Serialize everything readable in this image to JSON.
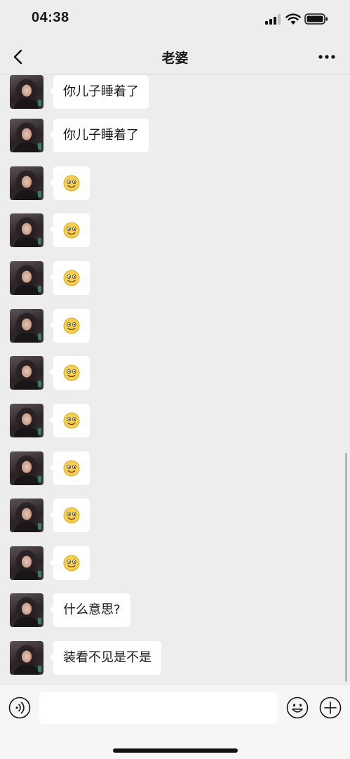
{
  "status": {
    "time": "04:38"
  },
  "header": {
    "title": "老婆"
  },
  "messages": [
    {
      "type": "text",
      "text": "你儿子睡着了"
    },
    {
      "type": "text",
      "text": "你儿子睡着了"
    },
    {
      "type": "emoji",
      "emoji": "smile-emoji"
    },
    {
      "type": "emoji",
      "emoji": "smile-emoji"
    },
    {
      "type": "emoji",
      "emoji": "smile-emoji"
    },
    {
      "type": "emoji",
      "emoji": "smile-emoji"
    },
    {
      "type": "emoji",
      "emoji": "smile-emoji"
    },
    {
      "type": "emoji",
      "emoji": "smile-emoji"
    },
    {
      "type": "emoji",
      "emoji": "smile-emoji"
    },
    {
      "type": "emoji",
      "emoji": "smile-emoji"
    },
    {
      "type": "emoji",
      "emoji": "smile-emoji"
    },
    {
      "type": "text",
      "text": "什么意思?"
    },
    {
      "type": "text",
      "text": "装看不见是不是"
    }
  ],
  "composer": {
    "value": "",
    "placeholder": ""
  }
}
